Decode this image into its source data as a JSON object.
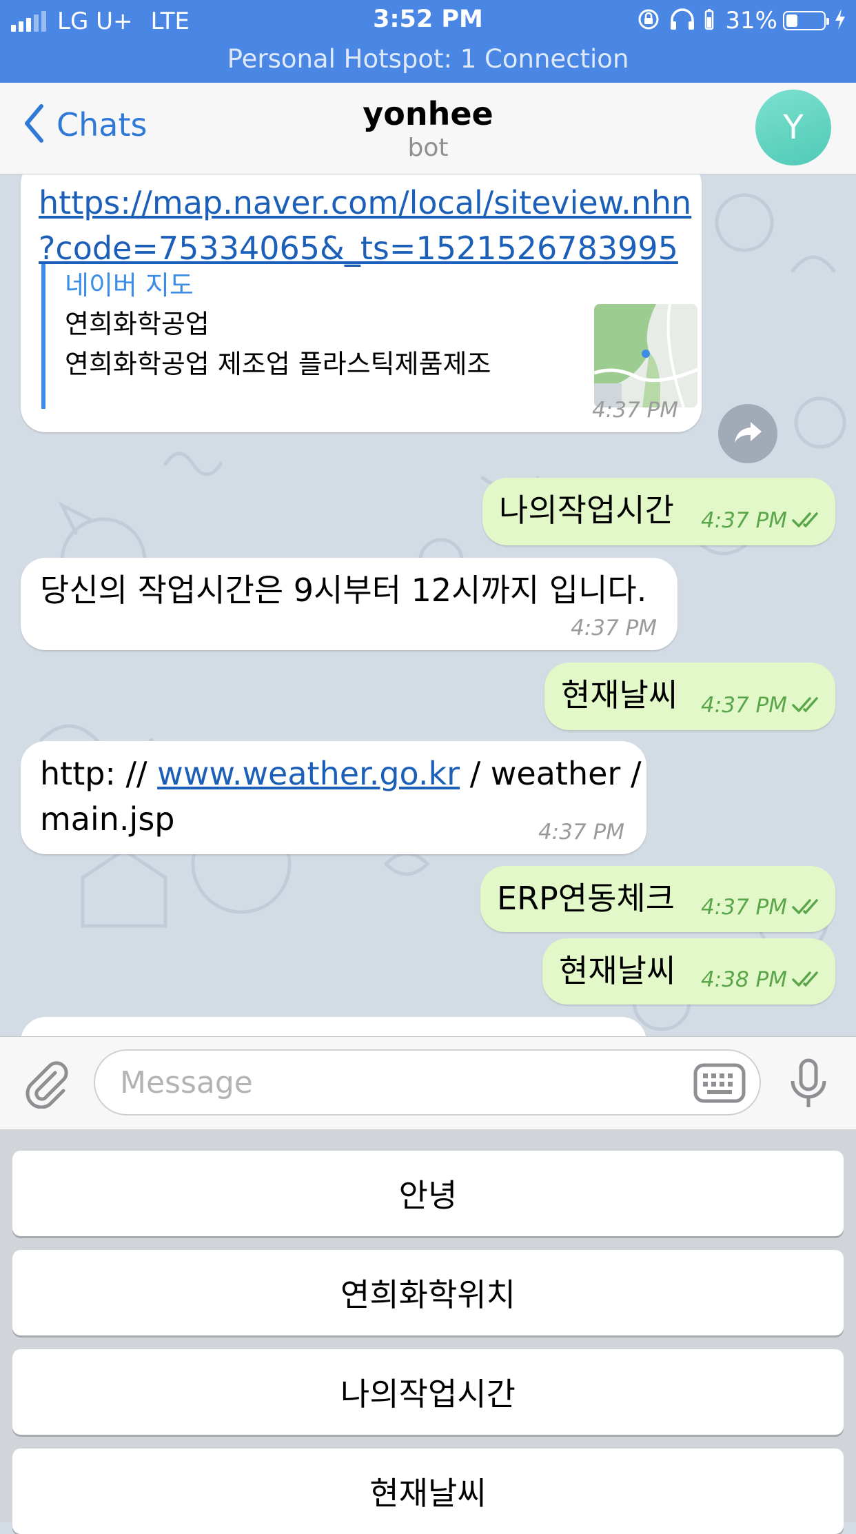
{
  "status_bar": {
    "carrier": "LG U+",
    "network": "LTE",
    "time": "3:52 PM",
    "battery": "31%",
    "battery_level": 0.31,
    "hotspot": "Personal Hotspot: 1 Connection"
  },
  "nav": {
    "back_label": "Chats",
    "title": "yonhee",
    "subtitle": "bot",
    "avatar_letter": "Y"
  },
  "messages": {
    "m1": {
      "link_line1": "https://map.naver.com/local/siteview.nhn",
      "link_line2": "?code=75334065&_ts=1521526783995",
      "preview_site": "네이버 지도",
      "preview_title": "연희화학공업",
      "preview_desc": "연희화학공업 제조업 플라스틱제품제조",
      "time": "4:37 PM"
    },
    "m2": {
      "text": "나의작업시간",
      "time": "4:37 PM"
    },
    "m3": {
      "text": "당신의 작업시간은 9시부터 12시까지 입니다.",
      "time": "4:37 PM"
    },
    "m4": {
      "text": "현재날씨",
      "time": "4:37 PM"
    },
    "m5": {
      "prefix": "http: //",
      "link": "www.weather.go.kr",
      "suffix": "/ weather /",
      "line2": "main.jsp",
      "time": "4:37 PM"
    },
    "m6": {
      "text": "ERP연동체크",
      "time": "4:37 PM"
    },
    "m7": {
      "text": "현재날씨",
      "time": "4:38 PM"
    }
  },
  "input": {
    "placeholder": "Message",
    "value": ""
  },
  "keyboard_buttons": {
    "b1": "안녕",
    "b2": "연희화학위치",
    "b3": "나의작업시간",
    "b4": "현재날씨"
  },
  "icons": {
    "back": "chevron-left-icon",
    "share": "share-icon",
    "attach": "paperclip-icon",
    "keyboard": "keyboard-icon",
    "mic": "microphone-icon",
    "read": "double-check-icon"
  },
  "colors": {
    "status_bar": "#4a86e4",
    "accent": "#2f7ad6",
    "outgoing_bubble": "#e2f8c8",
    "incoming_bubble": "#ffffff",
    "chat_background": "#d3dbe4"
  }
}
